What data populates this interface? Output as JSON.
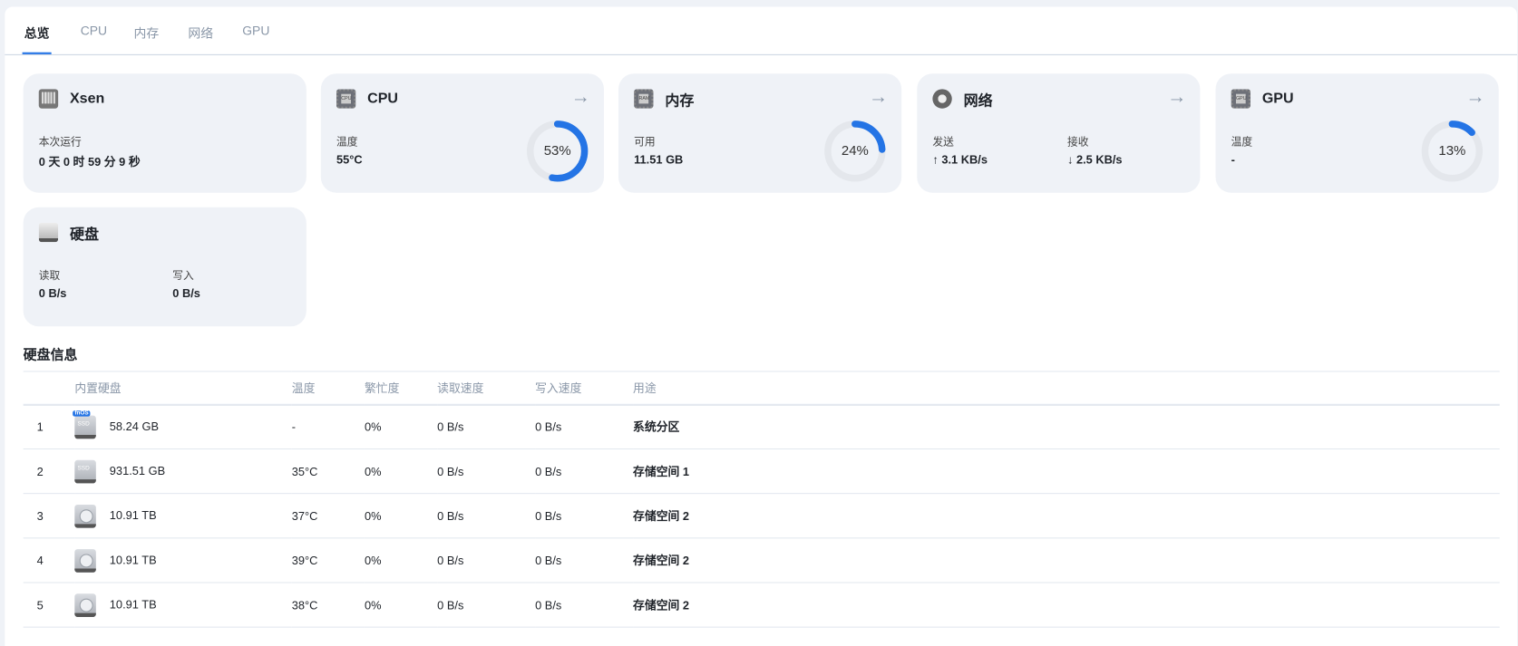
{
  "tabs": [
    "总览",
    "CPU",
    "内存",
    "网络",
    "GPU"
  ],
  "cards": {
    "system": {
      "title": "Xsen",
      "uptime_label": "本次运行",
      "uptime": "0 天 0 时 59 分 9 秒"
    },
    "cpu": {
      "title": "CPU",
      "temp_label": "温度",
      "temp": "55°C",
      "usage": 53,
      "usage_text": "53%",
      "chip": "CPU"
    },
    "memory": {
      "title": "内存",
      "avail_label": "可用",
      "avail": "11.51 GB",
      "usage": 24,
      "usage_text": "24%",
      "chip": "RAM"
    },
    "network": {
      "title": "网络",
      "send_label": "发送",
      "send": "↑ 3.1 KB/s",
      "recv_label": "接收",
      "recv": "↓ 2.5 KB/s"
    },
    "gpu": {
      "title": "GPU",
      "temp_label": "温度",
      "temp": "-",
      "usage": 13,
      "usage_text": "13%",
      "chip": "GPU"
    },
    "disk": {
      "title": "硬盘",
      "read_label": "读取",
      "read": "0 B/s",
      "write_label": "写入",
      "write": "0 B/s"
    }
  },
  "disk_info": {
    "title": "硬盘信息",
    "columns": [
      "内置硬盘",
      "温度",
      "繁忙度",
      "读取速度",
      "写入速度",
      "用途"
    ],
    "rows": [
      {
        "idx": "1",
        "type": "ssd",
        "badge": "fnOS",
        "size": "58.24 GB",
        "temp": "-",
        "busy": "0%",
        "read": "0 B/s",
        "write": "0 B/s",
        "use": "系统分区"
      },
      {
        "idx": "2",
        "type": "ssd",
        "size": "931.51 GB",
        "temp": "35°C",
        "busy": "0%",
        "read": "0 B/s",
        "write": "0 B/s",
        "use": "存储空间 1"
      },
      {
        "idx": "3",
        "type": "hdd",
        "size": "10.91 TB",
        "temp": "37°C",
        "busy": "0%",
        "read": "0 B/s",
        "write": "0 B/s",
        "use": "存储空间 2"
      },
      {
        "idx": "4",
        "type": "hdd",
        "size": "10.91 TB",
        "temp": "39°C",
        "busy": "0%",
        "read": "0 B/s",
        "write": "0 B/s",
        "use": "存储空间 2"
      },
      {
        "idx": "5",
        "type": "hdd",
        "size": "10.91 TB",
        "temp": "38°C",
        "busy": "0%",
        "read": "0 B/s",
        "write": "0 B/s",
        "use": "存储空间 2"
      }
    ]
  },
  "colors": {
    "accent": "#2474e5",
    "track": "#e4e7ec"
  }
}
